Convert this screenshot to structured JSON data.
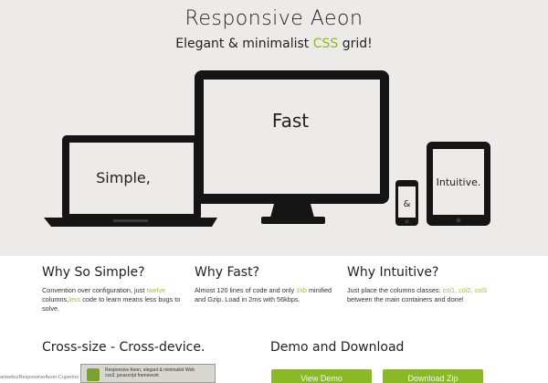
{
  "header": {
    "title": "Responsive Aeon",
    "tagline_pre": "Elegant & minimalist ",
    "tagline_hl": "CSS",
    "tagline_post": " grid!"
  },
  "devices": {
    "laptop_label": "Simple,",
    "monitor_label": "Fast",
    "phone_label": "&",
    "tablet_label": "Intuitive."
  },
  "features": [
    {
      "title": "Why So Simple?",
      "text_1": "Convention over configuration, just ",
      "hl_1": "twelve",
      "text_2": " columns,",
      "hl_2": "less",
      "text_3": " code to learn means less bugs to solve."
    },
    {
      "title": "Why Fast?",
      "text_1": "Almost 120 lines of code and only ",
      "hl_1": "1kb",
      "text_2": " minified and Gzip. Load in 2ms with 56kbps."
    },
    {
      "title": "Why Intuitive?",
      "text_1": "Just place the columns classes: ",
      "hl_1": "col1, col2, col3",
      "text_2": " between the main containers and done!"
    }
  ],
  "sections": {
    "cross_title": "Cross-size - Cross-device.",
    "demo_title": "Demo and Download",
    "footer_url": "ariwebs/ResponsiveAeon-Cuperino",
    "thumb_line1": "Responsive Aeon, elegant & minimalist Web",
    "thumb_line2": "css3, javascript framework"
  },
  "buttons": {
    "demo": "View Demo",
    "download": "Download Zip"
  },
  "colors": {
    "accent": "#8ab928",
    "hero_bg": "#ecebe8"
  }
}
